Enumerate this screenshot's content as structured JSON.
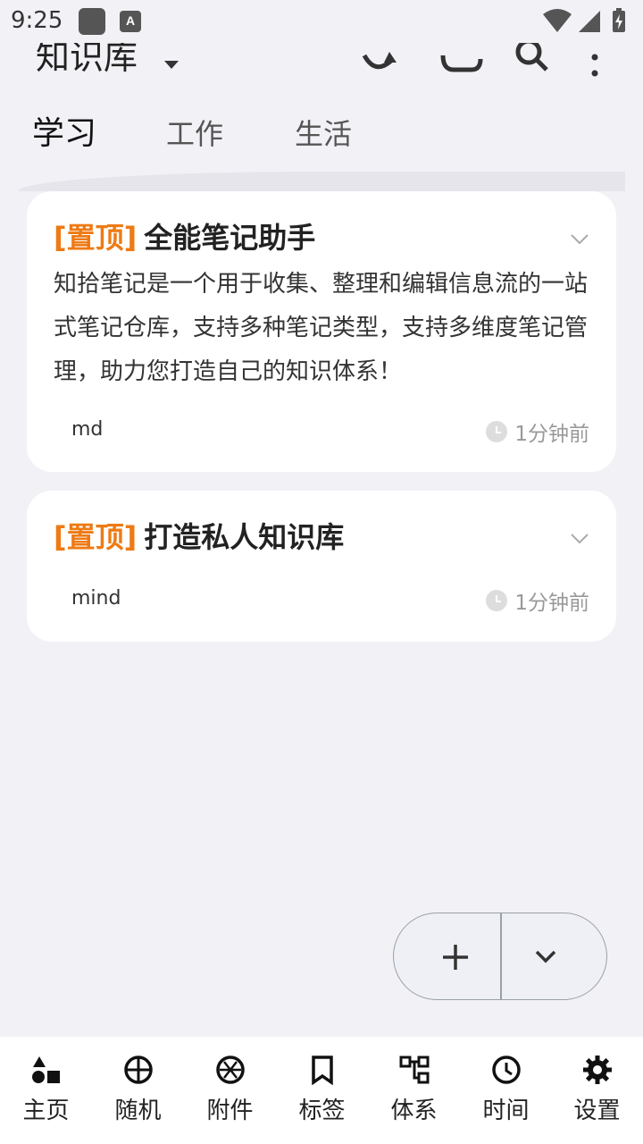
{
  "status_bar": {
    "time": "9:25",
    "notif_letter": "A"
  },
  "header": {
    "title": "知识库"
  },
  "tabs": [
    {
      "label": "学习",
      "active": true
    },
    {
      "label": "工作",
      "active": false
    },
    {
      "label": "生活",
      "active": false
    }
  ],
  "notes": [
    {
      "pin": "[置顶]",
      "title": "全能笔记助手",
      "body": "知拾笔记是一个用于收集、整理和编辑信息流的一站式笔记仓库，支持多种笔记类型，支持多维度笔记管理，助力您打造自己的知识体系！",
      "type": "md",
      "time": "1分钟前"
    },
    {
      "pin": "[置顶]",
      "title": "打造私人知识库",
      "body": "",
      "type": "mind",
      "time": "1分钟前"
    }
  ],
  "bottom_nav": [
    {
      "label": "主页",
      "icon": "home-shapes-icon"
    },
    {
      "label": "随机",
      "icon": "random-icon"
    },
    {
      "label": "附件",
      "icon": "aperture-icon"
    },
    {
      "label": "标签",
      "icon": "bookmark-icon"
    },
    {
      "label": "体系",
      "icon": "hierarchy-icon"
    },
    {
      "label": "时间",
      "icon": "clock-icon"
    },
    {
      "label": "设置",
      "icon": "gear-icon"
    }
  ],
  "colors": {
    "accent": "#ee7a14",
    "background": "#f2f1f6"
  }
}
